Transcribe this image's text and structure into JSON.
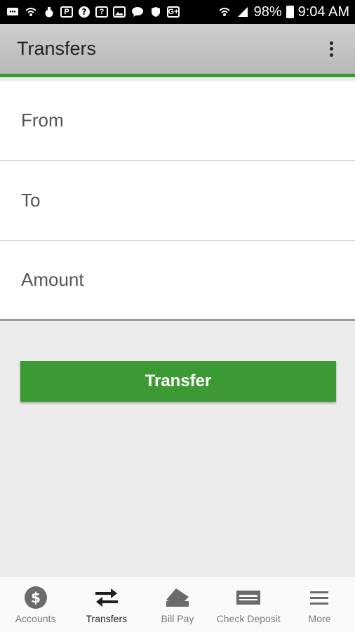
{
  "status_bar": {
    "battery": "98%",
    "time": "9:04 AM"
  },
  "app_bar": {
    "title": "Transfers"
  },
  "form": {
    "from_label": "From",
    "to_label": "To",
    "amount_label": "Amount"
  },
  "actions": {
    "transfer_label": "Transfer"
  },
  "nav": {
    "accounts": "Accounts",
    "transfers": "Transfers",
    "bill_pay": "Bill Pay",
    "check_deposit": "Check Deposit",
    "more": "More"
  },
  "colors": {
    "accent": "#3c9a35",
    "app_bar": "#c4c4c4"
  }
}
